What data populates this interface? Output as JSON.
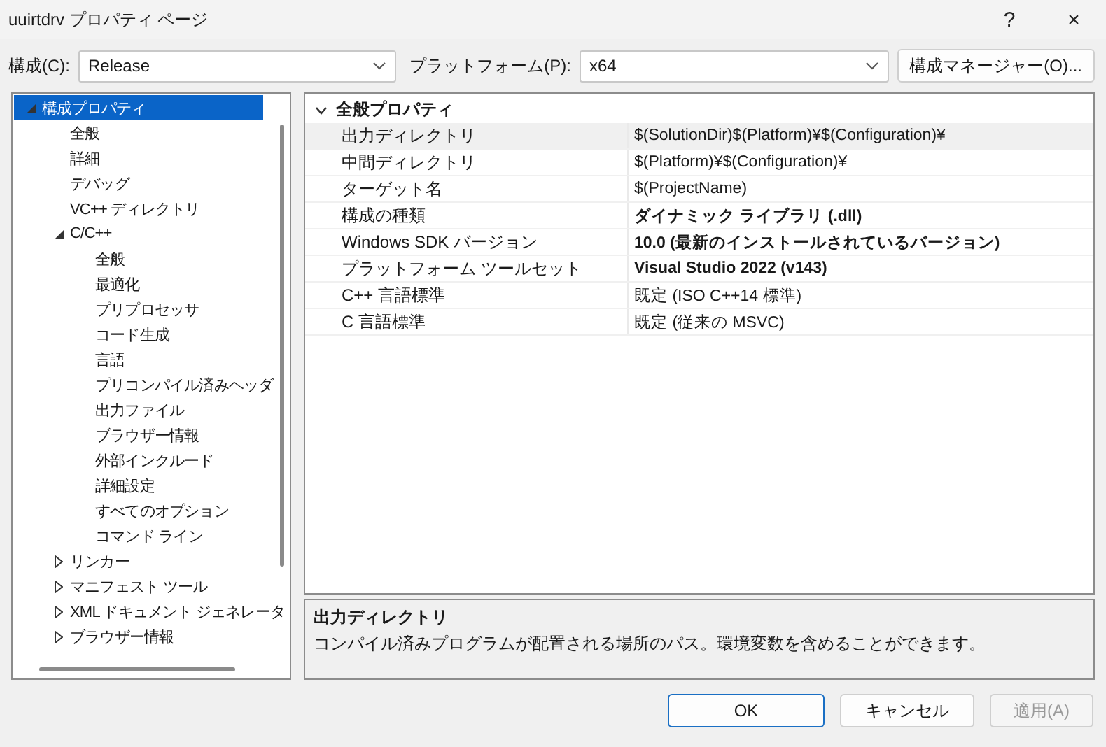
{
  "window": {
    "title": "uuirtdrv プロパティ ページ",
    "help": "?",
    "close": "×"
  },
  "toolbar": {
    "configuration_label": "構成(C):",
    "configuration": "Release",
    "platform_label": "プラットフォーム(P):",
    "platform": "x64",
    "manager_button": "構成マネージャー(O)..."
  },
  "tree": [
    {
      "label": "構成プロパティ",
      "selected": true,
      "expanded": true,
      "children": [
        {
          "label": "全般",
          "selected": false
        },
        {
          "label": "詳細",
          "selected": false
        },
        {
          "label": "デバッグ",
          "selected": false
        },
        {
          "label": "VC++ ディレクトリ",
          "selected": false
        },
        {
          "label": "C/C++",
          "selected": false,
          "expanded": true,
          "children": [
            {
              "label": "全般",
              "selected": false
            },
            {
              "label": "最適化",
              "selected": false
            },
            {
              "label": "プリプロセッサ",
              "selected": false
            },
            {
              "label": "コード生成",
              "selected": false
            },
            {
              "label": "言語",
              "selected": false
            },
            {
              "label": "プリコンパイル済みヘッダ",
              "selected": false
            },
            {
              "label": "出力ファイル",
              "selected": false
            },
            {
              "label": "ブラウザー情報",
              "selected": false
            },
            {
              "label": "外部インクルード",
              "selected": false
            },
            {
              "label": "詳細設定",
              "selected": false
            },
            {
              "label": "すべてのオプション",
              "selected": false
            },
            {
              "label": "コマンド ライン",
              "selected": false
            }
          ]
        },
        {
          "label": "リンカー",
          "selected": false,
          "expanded": false
        },
        {
          "label": "マニフェスト ツール",
          "selected": false,
          "expanded": false
        },
        {
          "label": "XML ドキュメント ジェネレータ",
          "selected": false,
          "expanded": false
        },
        {
          "label": "ブラウザー情報",
          "selected": false,
          "expanded": false
        }
      ]
    }
  ],
  "grid": {
    "category": "全般プロパティ",
    "expanded": true,
    "rows": [
      {
        "name": "出力ディレクトリ",
        "value": "$(SolutionDir)$(Platform)¥$(Configuration)¥",
        "bold": false,
        "selected": true
      },
      {
        "name": "中間ディレクトリ",
        "value": "$(Platform)¥$(Configuration)¥",
        "bold": false,
        "selected": false
      },
      {
        "name": "ターゲット名",
        "value": "$(ProjectName)",
        "bold": false,
        "selected": false
      },
      {
        "name": "構成の種類",
        "value": "ダイナミック ライブラリ (.dll)",
        "bold": true,
        "selected": false
      },
      {
        "name": "Windows SDK バージョン",
        "value": "10.0 (最新のインストールされているバージョン)",
        "bold": true,
        "selected": false
      },
      {
        "name": "プラットフォーム ツールセット",
        "value": "Visual Studio 2022 (v143)",
        "bold": true,
        "selected": false
      },
      {
        "name": "C++ 言語標準",
        "value": "既定 (ISO C++14 標準)",
        "bold": false,
        "selected": false
      },
      {
        "name": "C 言語標準",
        "value": "既定 (従来の MSVC)",
        "bold": false,
        "selected": false
      }
    ]
  },
  "description": {
    "title": "出力ディレクトリ",
    "text": "コンパイル済みプログラムが配置される場所のパス。環境変数を含めることができます。"
  },
  "buttons": [
    {
      "label": "OK",
      "kind": "default",
      "disabled": false
    },
    {
      "label": "キャンセル",
      "kind": "normal",
      "disabled": false
    },
    {
      "label": "適用(A)",
      "kind": "normal",
      "disabled": true
    }
  ]
}
